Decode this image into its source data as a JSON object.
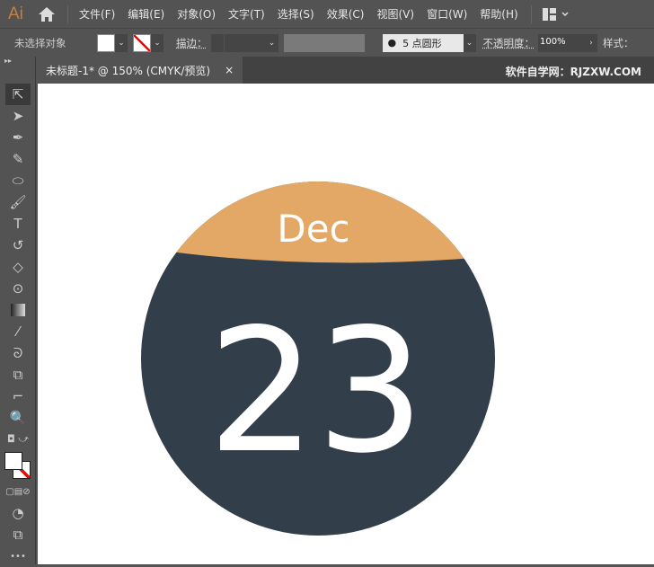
{
  "app": {
    "logo": "Ai"
  },
  "menu": [
    "文件(F)",
    "编辑(E)",
    "对象(O)",
    "文字(T)",
    "选择(S)",
    "效果(C)",
    "视图(V)",
    "窗口(W)",
    "帮助(H)"
  ],
  "control": {
    "selection": "未选择对象",
    "stroke_label": "描边：",
    "brush": "5 点圆形",
    "opacity_label": "不透明度：",
    "opacity": "100%",
    "style_label": "样式："
  },
  "tab": {
    "title": "未标题-1* @ 150% (CMYK/预览)",
    "close": "×"
  },
  "watermark": "软件自学网：RJZXW.COM",
  "artwork": {
    "month": "Dec",
    "day": "23",
    "colors": {
      "cap": "#E3A865",
      "body": "#323E49"
    }
  },
  "tools": [
    "selection",
    "direct-selection",
    "pen",
    "curvature",
    "ellipse",
    "paintbrush",
    "type",
    "rotate",
    "eraser",
    "shape-builder",
    "gradient",
    "eyedropper",
    "puppet-warp",
    "blend",
    "artboard",
    "zoom"
  ]
}
